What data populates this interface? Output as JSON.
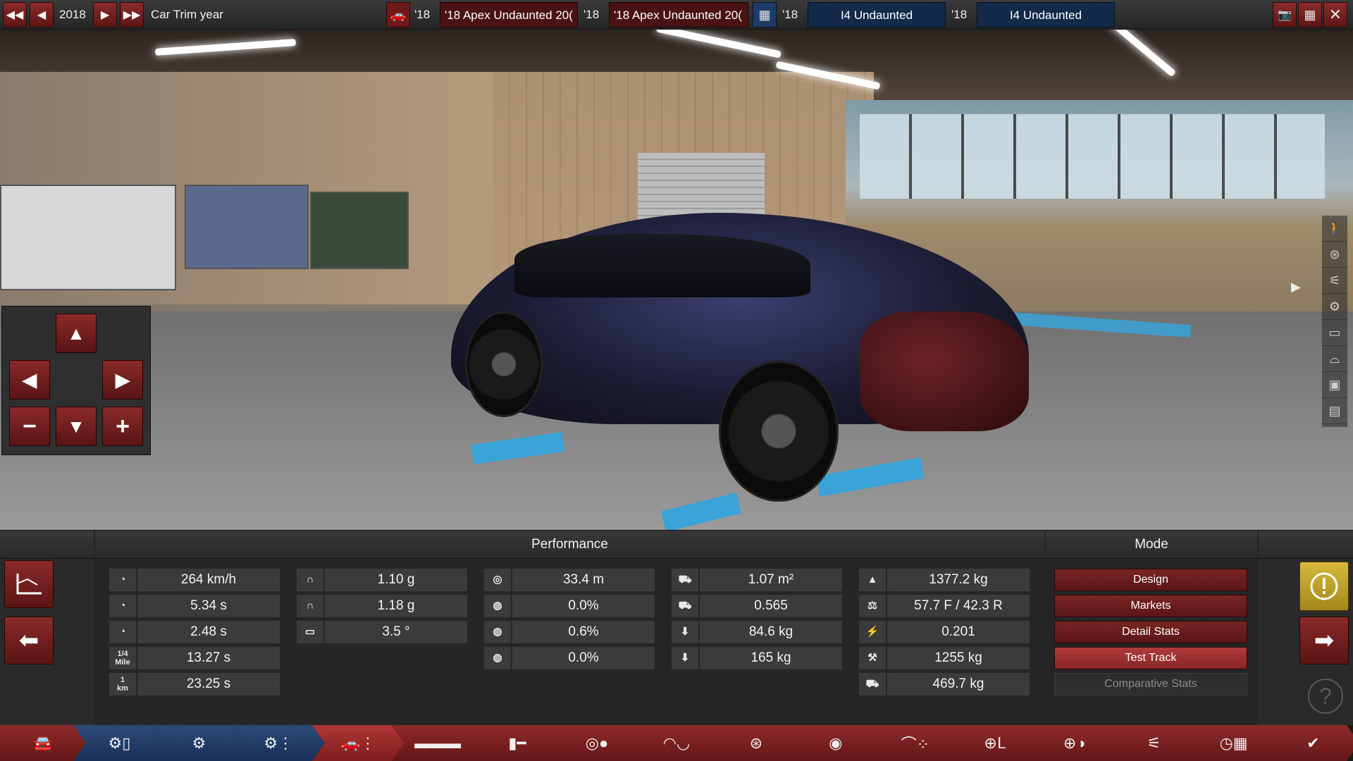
{
  "topbar": {
    "year": "2018",
    "label": "Car Trim year",
    "car_model_year": "'18",
    "car_model_name": "'18 Apex Undaunted 20(",
    "trim_year": "'18",
    "trim_name": "'18 Apex Undaunted 20(",
    "engine_family_year": "'18",
    "engine_family_name": "I4 Undaunted",
    "engine_variant_year": "'18",
    "engine_variant_name": "I4 Undaunted"
  },
  "camera_pad": {
    "up": "▲",
    "left": "◀",
    "right": "▶",
    "minus": "−",
    "down": "▼",
    "plus": "+"
  },
  "performance": {
    "title": "Performance",
    "col1": [
      {
        "icon": "speedometer-icon",
        "glyph": "◔",
        "value": "264 km/h"
      },
      {
        "icon": "acceleration-100-icon",
        "glyph": "◔",
        "value": "5.34 s"
      },
      {
        "icon": "acceleration-80-icon",
        "glyph": "◔",
        "value": "2.48 s"
      },
      {
        "icon": "quarter-mile-icon",
        "glyph": "1/4\nMile",
        "value": "13.27 s"
      },
      {
        "icon": "one-km-icon",
        "glyph": "1\nkm",
        "value": "23.25 s"
      }
    ],
    "col2": [
      {
        "icon": "cornering-icon",
        "glyph": "∩",
        "value": "1.10 g"
      },
      {
        "icon": "cornering-high-icon",
        "glyph": "∩",
        "value": "1.18 g"
      },
      {
        "icon": "body-roll-icon",
        "glyph": "▭",
        "value": "3.5 °"
      }
    ],
    "col3": [
      {
        "icon": "braking-distance-icon",
        "glyph": "◎",
        "value": "33.4 m"
      },
      {
        "icon": "brake-fade-icon",
        "glyph": "◍",
        "value": "0.0%"
      },
      {
        "icon": "wheel-slip-icon",
        "glyph": "◍",
        "value": "0.6%"
      },
      {
        "icon": "oversteer-icon",
        "glyph": "◍",
        "value": "0.0%"
      }
    ],
    "col4": [
      {
        "icon": "frontal-area-icon",
        "glyph": "⛟",
        "value": "1.07 m²"
      },
      {
        "icon": "drag-coefficient-icon",
        "glyph": "⛟",
        "value": "0.565"
      },
      {
        "icon": "front-downforce-icon",
        "glyph": "⬇",
        "value": "84.6 kg"
      },
      {
        "icon": "rear-downforce-icon",
        "glyph": "⬇",
        "value": "165 kg"
      }
    ],
    "col5": [
      {
        "icon": "weight-icon",
        "glyph": "▲",
        "value": "1377.2 kg"
      },
      {
        "icon": "weight-distribution-icon",
        "glyph": "⚖",
        "value": "57.7 F / 42.3 R"
      },
      {
        "icon": "power-to-weight-icon",
        "glyph": "⚡",
        "value": "0.201"
      },
      {
        "icon": "towing-capacity-icon",
        "glyph": "⚒",
        "value": "1255 kg"
      },
      {
        "icon": "cargo-capacity-icon",
        "glyph": "⛟",
        "value": "469.7 kg"
      }
    ]
  },
  "mode": {
    "title": "Mode",
    "buttons": [
      {
        "label": "Design",
        "state": "normal"
      },
      {
        "label": "Markets",
        "state": "normal"
      },
      {
        "label": "Detail Stats",
        "state": "normal"
      },
      {
        "label": "Test Track",
        "state": "active"
      },
      {
        "label": "Comparative Stats",
        "state": "disabled"
      }
    ]
  },
  "side_icons": [
    "pedestrian-icon",
    "wheel-icon",
    "suspension-icon",
    "engine-icon",
    "seat-icon",
    "car-side-icon",
    "radio-icon",
    "battery-icon"
  ],
  "nav": [
    {
      "name": "nav-car-model",
      "style": "red",
      "icon": "car-front-icon"
    },
    {
      "name": "nav-engine-family",
      "style": "blue",
      "icon": "engine-block-icon"
    },
    {
      "name": "nav-engine-parts",
      "style": "blue",
      "icon": "engine-parts-icon"
    },
    {
      "name": "nav-engine-tune",
      "style": "blue",
      "icon": "engine-tune-icon"
    },
    {
      "name": "nav-trim",
      "style": "redactive",
      "icon": "car-trim-icon"
    },
    {
      "name": "nav-chassis",
      "style": "red",
      "icon": "chassis-icon"
    },
    {
      "name": "nav-suspension",
      "style": "red",
      "icon": "suspension-icon"
    },
    {
      "name": "nav-drivetrain",
      "style": "red",
      "icon": "drivetrain-icon"
    },
    {
      "name": "nav-body",
      "style": "red",
      "icon": "body-icon"
    },
    {
      "name": "nav-wheels",
      "style": "red",
      "icon": "wheels-icon"
    },
    {
      "name": "nav-brakes",
      "style": "red",
      "icon": "brakes-icon"
    },
    {
      "name": "nav-aero",
      "style": "red",
      "icon": "aero-icon"
    },
    {
      "name": "nav-interior",
      "style": "red",
      "icon": "interior-icon"
    },
    {
      "name": "nav-assists",
      "style": "red",
      "icon": "assists-icon"
    },
    {
      "name": "nav-tune",
      "style": "red",
      "icon": "tune-icon"
    },
    {
      "name": "nav-test",
      "style": "red",
      "icon": "test-flag-icon"
    },
    {
      "name": "nav-finish",
      "style": "red",
      "icon": "checkmark-icon"
    }
  ],
  "colors": {
    "accent_red": "#8a2a2a",
    "accent_blue": "#1d3c6a",
    "warning_yellow": "#d6b93c"
  }
}
